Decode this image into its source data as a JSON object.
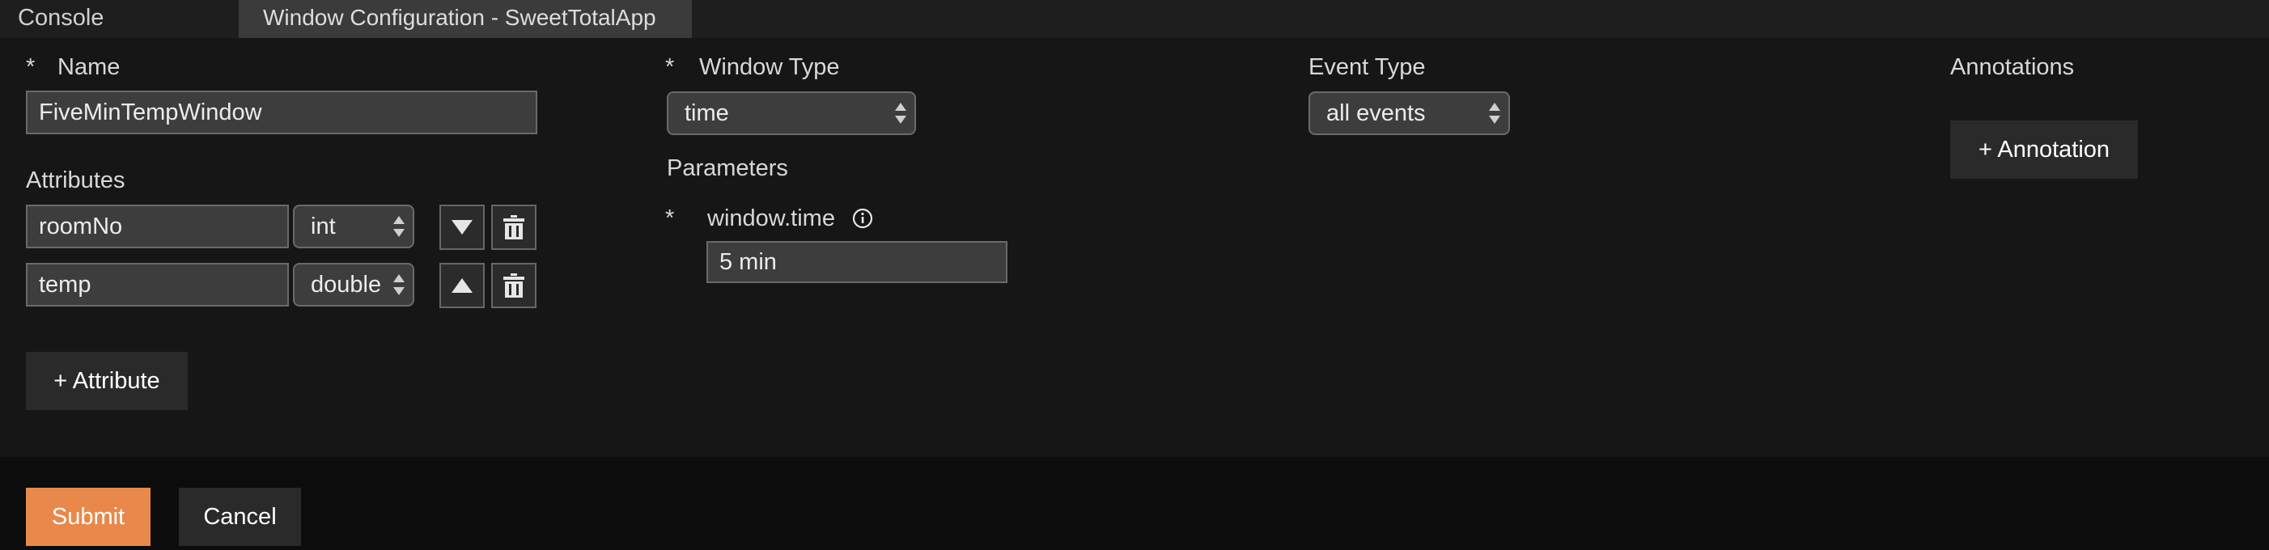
{
  "tabs": {
    "console": "Console",
    "window_config": "Window Configuration - SweetTotalApp"
  },
  "required_mark": "*",
  "name": {
    "label": "Name",
    "value": "FiveMinTempWindow"
  },
  "attributes": {
    "label": "Attributes",
    "rows": [
      {
        "name": "roomNo",
        "type": "int",
        "move_icon": "arrow-down-icon"
      },
      {
        "name": "temp",
        "type": "double",
        "move_icon": "arrow-up-icon"
      }
    ],
    "add_label": "+ Attribute"
  },
  "window_type": {
    "label": "Window Type",
    "value": "time"
  },
  "parameters": {
    "label": "Parameters",
    "param_name": "window.time",
    "param_value": "5 min",
    "info_icon": "info-icon"
  },
  "event_type": {
    "label": "Event Type",
    "value": "all events"
  },
  "annotations": {
    "label": "Annotations",
    "add_label": "+ Annotation"
  },
  "footer": {
    "submit_label": "Submit",
    "cancel_label": "Cancel"
  },
  "colors": {
    "accent": "#e8884a",
    "background": "#161616",
    "tabbar": "#1e1e1e"
  }
}
